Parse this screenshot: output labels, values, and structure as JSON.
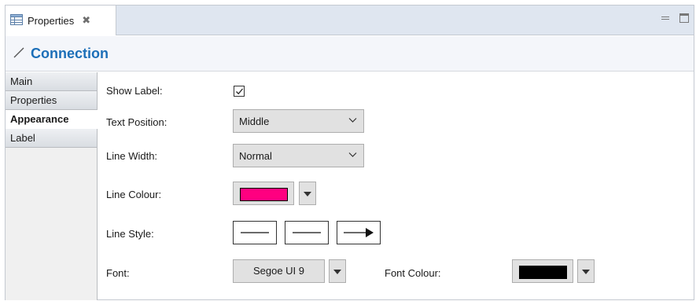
{
  "tab": {
    "label": "Properties",
    "close_glyph": "✖"
  },
  "header": {
    "title": "Connection"
  },
  "left_tabs": [
    {
      "label": "Main",
      "selected": false
    },
    {
      "label": "Properties",
      "selected": false
    },
    {
      "label": "Appearance",
      "selected": true
    },
    {
      "label": "Label",
      "selected": false
    }
  ],
  "form": {
    "show_label": {
      "label": "Show Label:",
      "checked": true
    },
    "text_position": {
      "label": "Text Position:",
      "value": "Middle"
    },
    "line_width": {
      "label": "Line Width:",
      "value": "Normal"
    },
    "line_colour": {
      "label": "Line Colour:",
      "color": "#ff0080"
    },
    "line_style": {
      "label": "Line Style:",
      "options": [
        "solid-line",
        "solid-line",
        "arrow-line"
      ]
    },
    "font": {
      "label": "Font:",
      "value": "Segoe UI 9"
    },
    "font_colour": {
      "label": "Font Colour:",
      "color": "#000000"
    }
  },
  "colors": {
    "accent": "#1c6fb8",
    "tabstrip_bg": "#dfe6f0",
    "header_bg": "#f4f6fa"
  },
  "icons": [
    "properties-table-icon",
    "close-icon",
    "minimize-icon",
    "maximize-icon",
    "connection-line-icon",
    "checkmark-icon",
    "chevron-down-icon",
    "dropdown-arrow-icon"
  ]
}
